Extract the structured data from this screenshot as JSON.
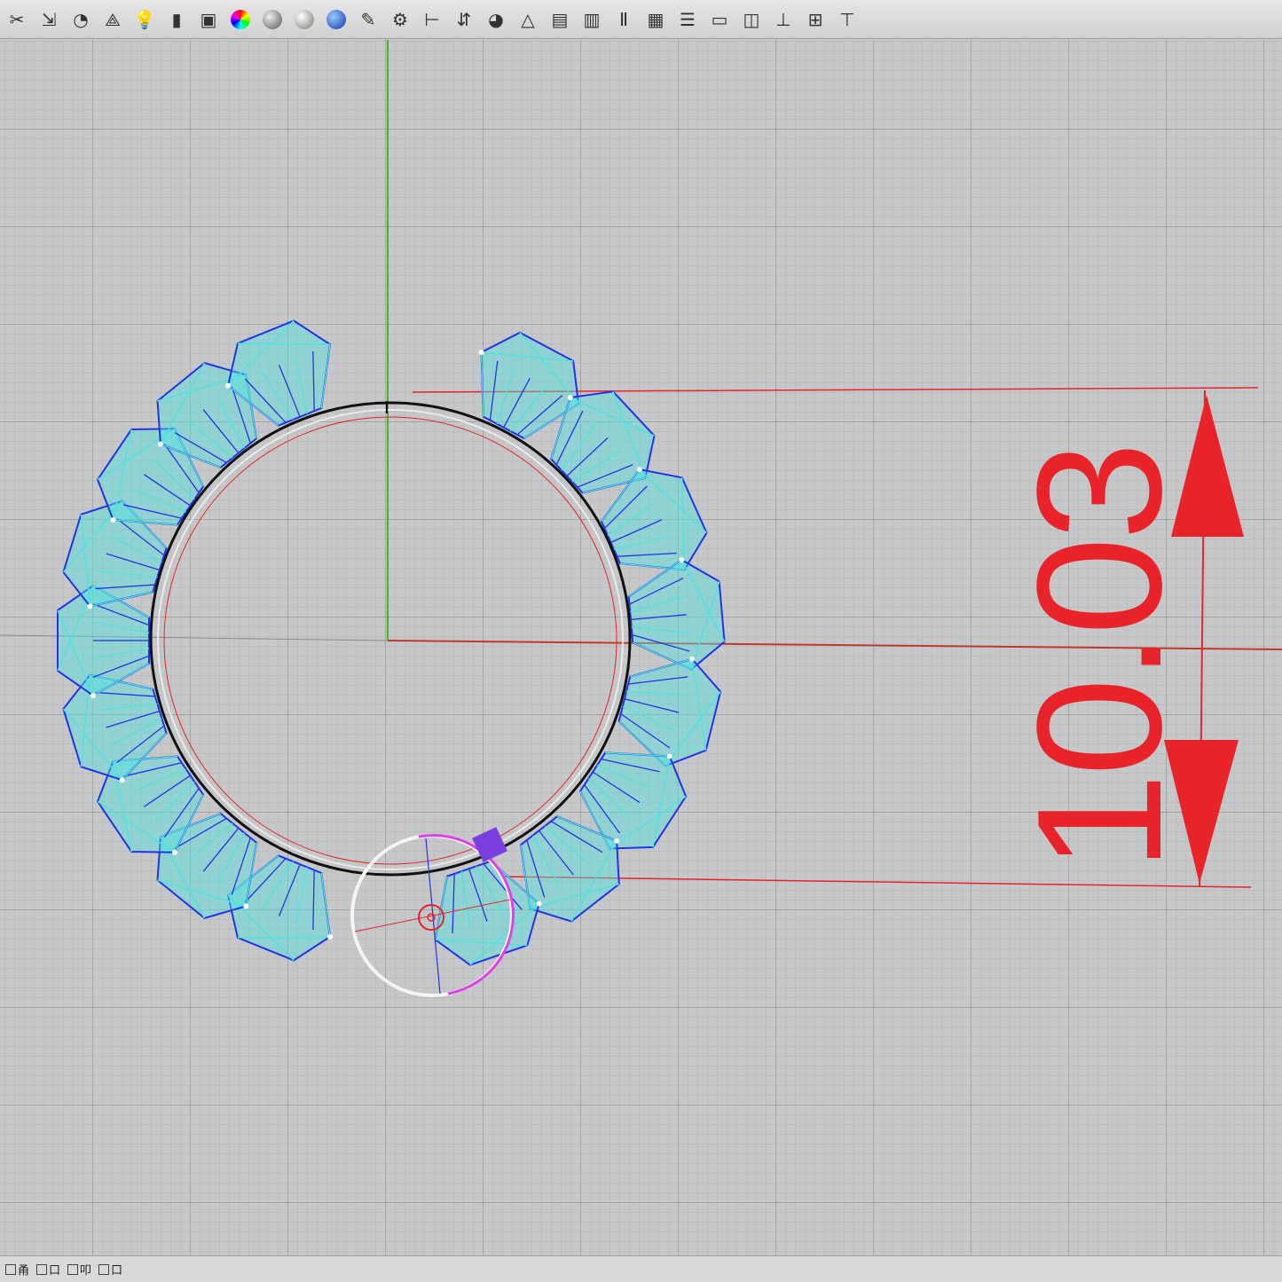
{
  "toolbar": {
    "tools": [
      {
        "name": "scissors-icon",
        "glyph": "✂"
      },
      {
        "name": "dimension-icon",
        "glyph": "⇲"
      },
      {
        "name": "circle-tool-icon",
        "glyph": "◔"
      },
      {
        "name": "shapes-icon",
        "glyph": "⟁"
      },
      {
        "name": "lightbulb-icon",
        "glyph": "💡"
      },
      {
        "name": "battery-icon",
        "glyph": "▮"
      },
      {
        "name": "layer-cube-icon",
        "glyph": "▣"
      },
      {
        "name": "color-wheel-icon",
        "ball": "conic-gradient(red, yellow, lime, cyan, blue, magenta, red)"
      },
      {
        "name": "sphere-gray-icon",
        "ball": "radial-gradient(circle at 35% 35%, #eee, #555)"
      },
      {
        "name": "sphere-white-icon",
        "ball": "radial-gradient(circle at 35% 35%, #fff, #777)"
      },
      {
        "name": "sphere-blue-icon",
        "ball": "radial-gradient(circle at 35% 35%, #9cf, #13a)"
      },
      {
        "name": "pen-icon",
        "glyph": "✎"
      },
      {
        "name": "gear-icon",
        "glyph": "⚙"
      },
      {
        "name": "align-icon",
        "glyph": "⊢"
      },
      {
        "name": "transform-icon",
        "glyph": "⇵"
      },
      {
        "name": "globe-icon",
        "glyph": "◕"
      },
      {
        "name": "pyramid-icon",
        "glyph": "△"
      },
      {
        "name": "box-icon",
        "glyph": "▤"
      },
      {
        "name": "chart-icon",
        "glyph": "▥"
      },
      {
        "name": "text-icon",
        "glyph": "Ⅱ"
      },
      {
        "name": "grid-icon",
        "glyph": "▦"
      },
      {
        "name": "list-icon",
        "glyph": "☰"
      },
      {
        "name": "window-icon",
        "glyph": "▭"
      },
      {
        "name": "layers-icon",
        "glyph": "◫"
      },
      {
        "name": "pin-icon",
        "glyph": "⊥"
      },
      {
        "name": "table-icon",
        "glyph": "⊞"
      },
      {
        "name": "more-icon",
        "glyph": "⊤"
      }
    ]
  },
  "dimension": {
    "value": "10.03",
    "color": "#e8242a"
  },
  "colors": {
    "ring": "#111111",
    "gem_outline": "#2432e6",
    "gem_fill": "#4fe3e0",
    "axis_y": "#4caf28",
    "axis_x": "#c0392b",
    "gizmo_magenta": "#e040e8",
    "gizmo_purple": "#7b3fe0"
  },
  "statusbar": {
    "items": [
      "甬",
      "口",
      "叩",
      "口"
    ]
  }
}
